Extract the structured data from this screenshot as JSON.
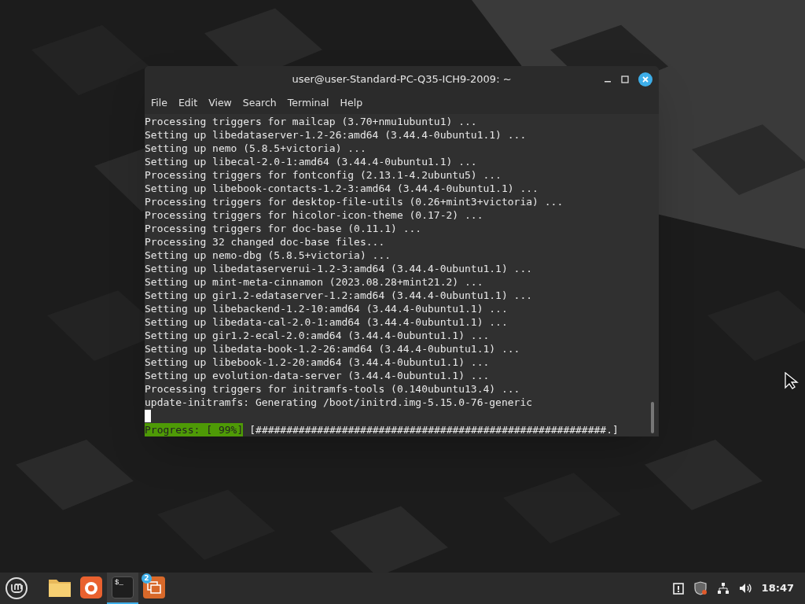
{
  "window": {
    "title": "user@user-Standard-PC-Q35-ICH9-2009: ~"
  },
  "menu": [
    "File",
    "Edit",
    "View",
    "Search",
    "Terminal",
    "Help"
  ],
  "terminal": {
    "lines": [
      "Processing triggers for mailcap (3.70+nmu1ubuntu1) ...",
      "Setting up libedataserver-1.2-26:amd64 (3.44.4-0ubuntu1.1) ...",
      "Setting up nemo (5.8.5+victoria) ...",
      "Setting up libecal-2.0-1:amd64 (3.44.4-0ubuntu1.1) ...",
      "Processing triggers for fontconfig (2.13.1-4.2ubuntu5) ...",
      "Setting up libebook-contacts-1.2-3:amd64 (3.44.4-0ubuntu1.1) ...",
      "Processing triggers for desktop-file-utils (0.26+mint3+victoria) ...",
      "Processing triggers for hicolor-icon-theme (0.17-2) ...",
      "Processing triggers for doc-base (0.11.1) ...",
      "Processing 32 changed doc-base files...",
      "Setting up nemo-dbg (5.8.5+victoria) ...",
      "Setting up libedataserverui-1.2-3:amd64 (3.44.4-0ubuntu1.1) ...",
      "Setting up mint-meta-cinnamon (2023.08.28+mint21.2) ...",
      "Setting up gir1.2-edataserver-1.2:amd64 (3.44.4-0ubuntu1.1) ...",
      "Setting up libebackend-1.2-10:amd64 (3.44.4-0ubuntu1.1) ...",
      "Setting up libedata-cal-2.0-1:amd64 (3.44.4-0ubuntu1.1) ...",
      "Setting up gir1.2-ecal-2.0:amd64 (3.44.4-0ubuntu1.1) ...",
      "Setting up libedata-book-1.2-26:amd64 (3.44.4-0ubuntu1.1) ...",
      "Setting up libebook-1.2-20:amd64 (3.44.4-0ubuntu1.1) ...",
      "Setting up evolution-data-server (3.44.4-0ubuntu1.1) ...",
      "Processing triggers for initramfs-tools (0.140ubuntu13.4) ...",
      "update-initramfs: Generating /boot/initrd.img-5.15.0-76-generic"
    ],
    "progress_label": "Progress: [ 99%]",
    "progress_bar": "[#########################################################.]"
  },
  "taskbar": {
    "apps": [
      {
        "kind": "folder",
        "selected": false
      },
      {
        "kind": "firefox",
        "selected": false
      },
      {
        "kind": "terminal",
        "selected": true,
        "glyph": "$_"
      },
      {
        "kind": "windows",
        "selected": false,
        "badge": "2"
      }
    ],
    "clock": "18:47"
  }
}
